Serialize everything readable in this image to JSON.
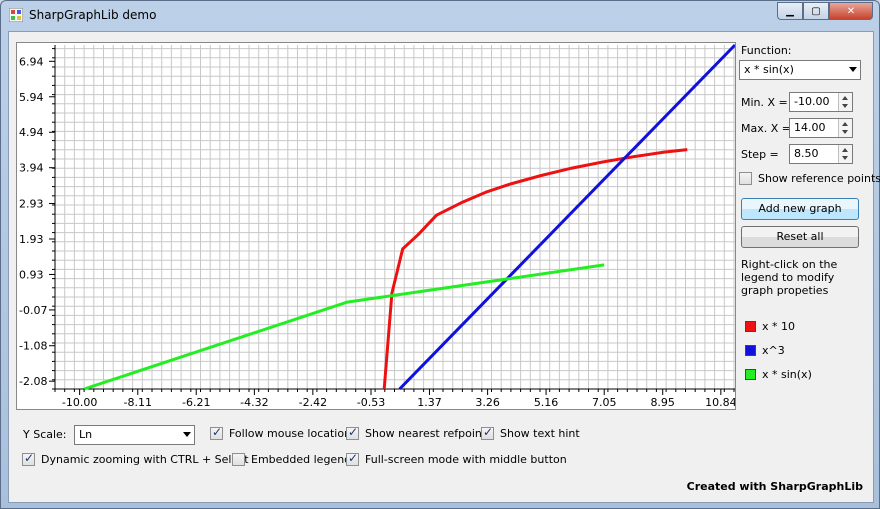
{
  "window": {
    "title": "SharpGraphLib demo"
  },
  "plot": {
    "y_ticks": [
      "6.94",
      "5.94",
      "4.94",
      "3.94",
      "2.93",
      "1.93",
      "0.93",
      "-0.07",
      "-1.08",
      "-2.08"
    ],
    "x_ticks": [
      "-10.00",
      "-8.11",
      "-6.21",
      "-4.32",
      "-2.42",
      "-0.53",
      "1.37",
      "3.26",
      "5.16",
      "7.05",
      "8.95",
      "10.84"
    ]
  },
  "chart_data": {
    "type": "line",
    "xlim": [
      -10.8,
      11.3
    ],
    "ylim": [
      -2.3,
      7.4
    ],
    "series": [
      {
        "name": "x * 10",
        "color": "#ee1111",
        "points": [
          [
            -0.1,
            -2.3
          ],
          [
            0.15,
            0.4
          ],
          [
            0.5,
            1.65
          ],
          [
            1.0,
            2.05
          ],
          [
            1.6,
            2.6
          ],
          [
            2.4,
            2.95
          ],
          [
            3.2,
            3.25
          ],
          [
            4.0,
            3.48
          ],
          [
            5.0,
            3.72
          ],
          [
            6.0,
            3.93
          ],
          [
            7.0,
            4.1
          ],
          [
            8.0,
            4.25
          ],
          [
            9.0,
            4.38
          ],
          [
            9.75,
            4.45
          ]
        ]
      },
      {
        "name": "x^3",
        "color": "#1111dd",
        "points": [
          [
            0.4,
            -2.3
          ],
          [
            11.3,
            7.4
          ]
        ]
      },
      {
        "name": "x * sin(x)",
        "color": "#22ee22",
        "points": [
          [
            -9.85,
            -2.3
          ],
          [
            -1.3,
            0.15
          ],
          [
            7.05,
            1.2
          ]
        ]
      }
    ]
  },
  "side": {
    "function_label": "Function:",
    "function_value": "x * sin(x)",
    "min_x_label": "Min. X =",
    "min_x_value": "-10.00",
    "max_x_label": "Max. X =",
    "max_x_value": "14.00",
    "step_label": "Step =",
    "step_value": "8.50",
    "show_ref_points": "Show reference points",
    "add_graph": "Add new graph",
    "reset_all": "Reset all",
    "hint": "Right-click on the legend to modify graph propeties",
    "legend": [
      {
        "label": "x * 10",
        "color": "#ee1111"
      },
      {
        "label": "x^3",
        "color": "#1111dd"
      },
      {
        "label": "x * sin(x)",
        "color": "#22ee22"
      }
    ]
  },
  "bottom": {
    "y_scale_label": "Y Scale:",
    "y_scale_value": "Ln",
    "follow_mouse": "Follow mouse location",
    "show_nearest": "Show nearest refpoint",
    "show_text_hint": "Show text hint",
    "dynamic_zoom": "Dynamic zooming with CTRL + Select",
    "embedded_legend": "Embedded legend",
    "fullscreen": "Full-screen mode with middle button"
  },
  "footer": "Created with SharpGraphLib"
}
